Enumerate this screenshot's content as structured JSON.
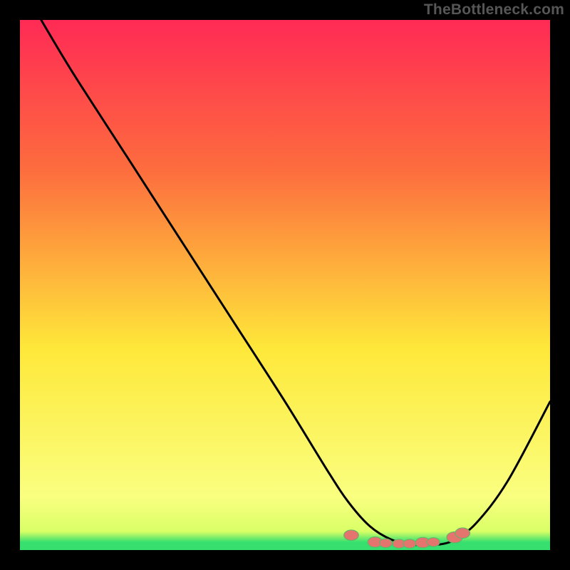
{
  "watermark": "TheBottleneck.com",
  "colors": {
    "background": "#000000",
    "gradient_top": "#ff2a55",
    "gradient_mid_upper": "#fd6c3e",
    "gradient_mid": "#fee83a",
    "gradient_lower": "#faff80",
    "gradient_bottom": "#37e06e",
    "curve": "#000000",
    "marker_fill": "#e4756e",
    "marker_stroke": "#57b867"
  },
  "chart_data": {
    "type": "line",
    "title": "",
    "xlabel": "",
    "ylabel": "",
    "xlim": [
      0,
      100
    ],
    "ylim": [
      0,
      100
    ],
    "series": [
      {
        "name": "bottleneck-curve",
        "x": [
          4,
          10,
          20,
          30,
          40,
          50,
          58,
          62,
          66,
          70,
          74,
          78,
          80,
          82,
          86,
          92,
          100
        ],
        "y": [
          100,
          90,
          74.5,
          59,
          43.5,
          28,
          15,
          9,
          4.5,
          2,
          1,
          1,
          1.2,
          2,
          5,
          13,
          28
        ]
      }
    ],
    "markers": {
      "name": "highlight-cluster",
      "points": [
        {
          "x": 62.5,
          "y": 2.8,
          "r": 1.4
        },
        {
          "x": 67,
          "y": 1.5,
          "r": 1.4
        },
        {
          "x": 69,
          "y": 1.3,
          "r": 1.2
        },
        {
          "x": 71.5,
          "y": 1.2,
          "r": 1.2
        },
        {
          "x": 73.5,
          "y": 1.2,
          "r": 1.2
        },
        {
          "x": 76,
          "y": 1.4,
          "r": 1.4
        },
        {
          "x": 78,
          "y": 1.5,
          "r": 1.2
        },
        {
          "x": 82,
          "y": 2.4,
          "r": 1.5
        },
        {
          "x": 83.5,
          "y": 3.2,
          "r": 1.4
        }
      ]
    }
  }
}
